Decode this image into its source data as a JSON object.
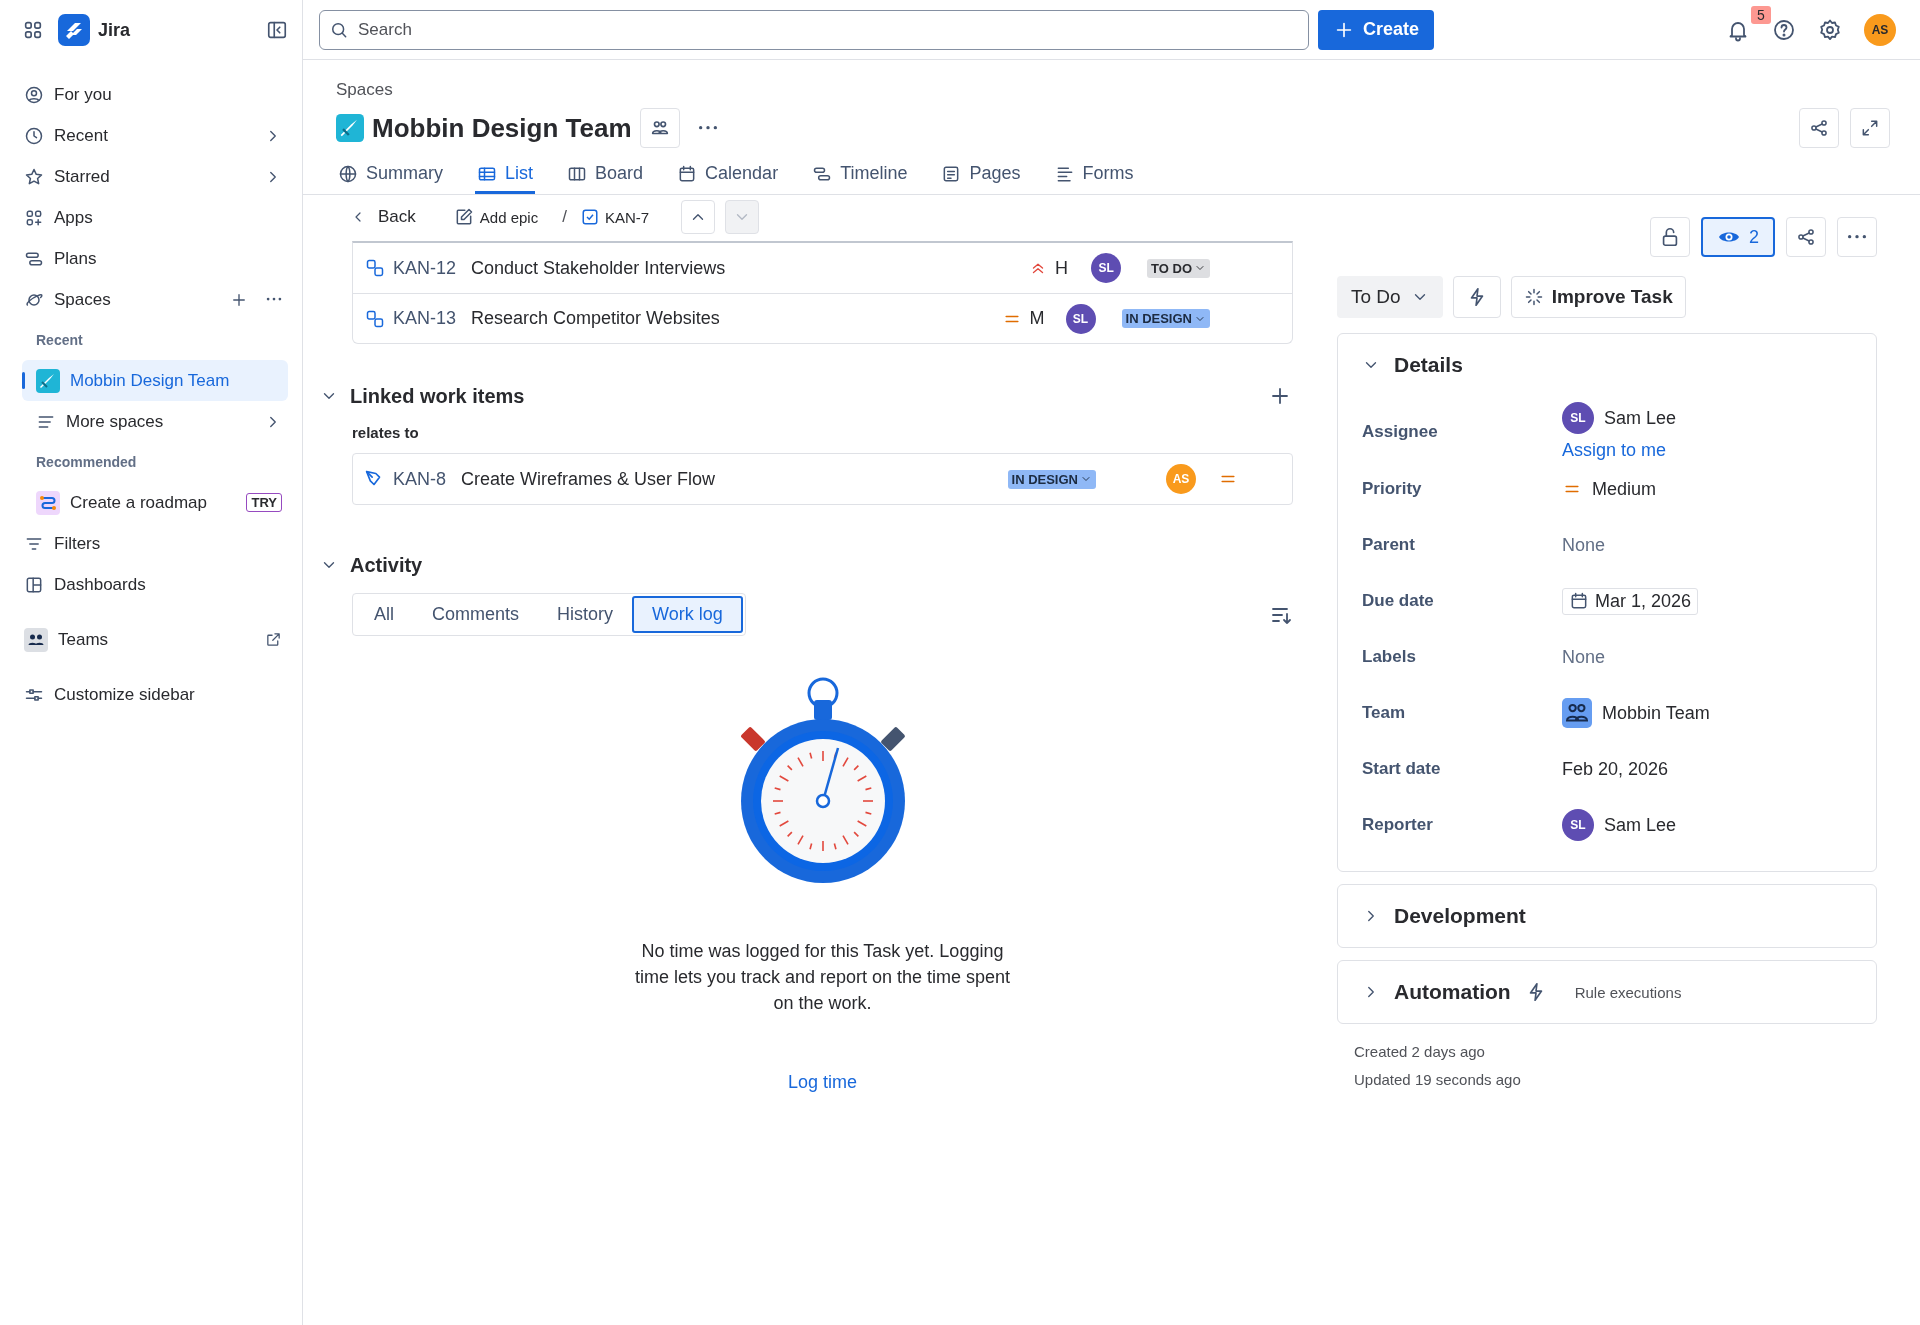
{
  "topbar": {
    "app_name": "Jira",
    "search_placeholder": "Search",
    "create_label": "Create",
    "notifications": "5",
    "user": {
      "initials": "AS",
      "color": "#f99a1c"
    }
  },
  "sidebar": {
    "items": [
      {
        "kind": "nav",
        "label": "For you",
        "selected": false,
        "expandable": false
      },
      {
        "kind": "nav",
        "label": "Recent",
        "selected": false,
        "expandable": true
      },
      {
        "kind": "nav",
        "label": "Starred",
        "selected": false,
        "expandable": true
      },
      {
        "kind": "nav",
        "label": "Apps",
        "selected": false,
        "expandable": false
      },
      {
        "kind": "nav",
        "label": "Plans",
        "selected": false,
        "expandable": false
      },
      {
        "kind": "spaces",
        "label": "Spaces",
        "selected": false,
        "expandable": false
      },
      {
        "kind": "heading",
        "label": "Recent"
      },
      {
        "kind": "space",
        "label": "Mobbin Design Team",
        "selected": true,
        "expandable": false
      },
      {
        "kind": "sub",
        "label": "More spaces",
        "selected": false,
        "expandable": true
      },
      {
        "kind": "heading",
        "label": "Recommended"
      },
      {
        "kind": "promo",
        "label": "Create a roadmap",
        "badge": "TRY",
        "selected": false,
        "expandable": false
      },
      {
        "kind": "nav",
        "label": "Filters",
        "selected": false,
        "expandable": false
      },
      {
        "kind": "nav",
        "label": "Dashboards",
        "selected": false,
        "expandable": false
      },
      {
        "kind": "external",
        "label": "Teams",
        "selected": false,
        "expandable": false
      },
      {
        "kind": "nav",
        "label": "Customize sidebar",
        "selected": false,
        "expandable": false
      }
    ]
  },
  "header": {
    "breadcrumb": "Spaces",
    "title": "Mobbin Design Team",
    "tabs": [
      {
        "label": "Summary",
        "selected": false
      },
      {
        "label": "List",
        "selected": true
      },
      {
        "label": "Board",
        "selected": false
      },
      {
        "label": "Calendar",
        "selected": false
      },
      {
        "label": "Timeline",
        "selected": false
      },
      {
        "label": "Pages",
        "selected": false
      },
      {
        "label": "Forms",
        "selected": false
      }
    ]
  },
  "item_toolbar": {
    "back": "Back",
    "add_epic": "Add epic",
    "separator": "/",
    "key": "KAN-7",
    "prev_disabled": false,
    "next_disabled": true
  },
  "child_items": [
    {
      "key": "KAN-12",
      "summary": "Conduct Stakeholder Interviews",
      "priority": {
        "kind": "high",
        "label": "H"
      },
      "assignee": {
        "initials": "SL",
        "color": "#5e4db2"
      },
      "status": {
        "kind": "todo",
        "label": "TO DO"
      }
    },
    {
      "key": "KAN-13",
      "summary": "Research Competitor Websites",
      "priority": {
        "kind": "medium",
        "label": "M"
      },
      "assignee": {
        "initials": "SL",
        "color": "#5e4db2"
      },
      "status": {
        "kind": "progress",
        "label": "IN DESIGN"
      }
    }
  ],
  "linked": {
    "title": "Linked work items",
    "relation": "relates to",
    "items": [
      {
        "key": "KAN-8",
        "summary": "Create Wireframes & User Flow",
        "status": {
          "kind": "progress",
          "label": "IN DESIGN"
        },
        "assignee": {
          "initials": "AS",
          "color": "#f99a1c"
        },
        "priority": {
          "kind": "medium"
        }
      }
    ]
  },
  "activity": {
    "title": "Activity",
    "tabs": [
      {
        "label": "All",
        "selected": false
      },
      {
        "label": "Comments",
        "selected": false
      },
      {
        "label": "History",
        "selected": false
      },
      {
        "label": "Work log",
        "selected": true
      }
    ],
    "empty_text": "No time was logged for this Task yet. Logging time lets you track and report on the time spent on the work.",
    "action": "Log time"
  },
  "side": {
    "watchers": "2",
    "status": "To Do",
    "improve": "Improve Task",
    "panels": [
      {
        "title": "Details",
        "expanded": true,
        "fields": [
          {
            "label": "Assignee",
            "kind": "user",
            "value": "Sam Lee",
            "avatar": {
              "initials": "SL",
              "color": "#5e4db2"
            },
            "link": "Assign to me"
          },
          {
            "label": "Priority",
            "kind": "priority",
            "value": "Medium"
          },
          {
            "label": "Parent",
            "kind": "empty",
            "value": "None"
          },
          {
            "label": "Due date",
            "kind": "date",
            "value": "Mar 1, 2026"
          },
          {
            "label": "Labels",
            "kind": "empty",
            "value": "None"
          },
          {
            "label": "Team",
            "kind": "team",
            "value": "Mobbin Team"
          },
          {
            "label": "Start date",
            "kind": "text",
            "value": "Feb 20, 2026"
          },
          {
            "label": "Reporter",
            "kind": "user",
            "value": "Sam Lee",
            "avatar": {
              "initials": "SL",
              "color": "#5e4db2"
            }
          }
        ]
      },
      {
        "title": "Development",
        "expanded": false
      },
      {
        "title": "Automation",
        "expanded": false,
        "note": "Rule executions"
      }
    ],
    "created": "Created 2 days ago",
    "updated": "Updated 19 seconds ago"
  }
}
